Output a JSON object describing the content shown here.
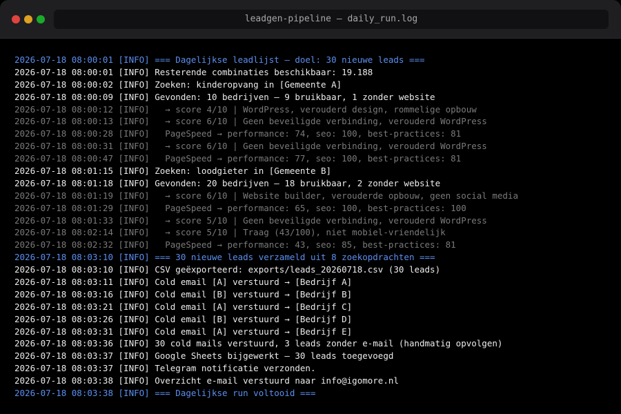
{
  "window": {
    "title": "leadgen-pipeline — daily_run.log"
  },
  "colors": {
    "bright": "#ececec",
    "dim": "#7a7a7a",
    "accent": "#5b8ff0"
  },
  "log": {
    "lines": [
      {
        "text": "2026-07-18 08:00:01 [INFO] === Dagelijkse leadlijst — doel: 30 nieuwe leads ===",
        "style": "accent"
      },
      {
        "text": "2026-07-18 08:00:01 [INFO] Resterende combinaties beschikbaar: 19.188",
        "style": "bright"
      },
      {
        "text": "2026-07-18 08:00:02 [INFO] Zoeken: kinderopvang in [Gemeente A]",
        "style": "bright"
      },
      {
        "text": "2026-07-18 08:00:09 [INFO] Gevonden: 10 bedrijven — 9 bruikbaar, 1 zonder website",
        "style": "bright"
      },
      {
        "text": "2026-07-18 08:00:12 [INFO]   → score 4/10 | WordPress, verouderd design, rommelige opbouw",
        "style": "dim"
      },
      {
        "text": "2026-07-18 08:00:13 [INFO]   → score 6/10 | Geen beveiligde verbinding, verouderd WordPress",
        "style": "dim"
      },
      {
        "text": "2026-07-18 08:00:28 [INFO]   PageSpeed → performance: 74, seo: 100, best-practices: 81",
        "style": "dim"
      },
      {
        "text": "2026-07-18 08:00:31 [INFO]   → score 6/10 | Geen beveiligde verbinding, verouderd WordPress",
        "style": "dim"
      },
      {
        "text": "2026-07-18 08:00:47 [INFO]   PageSpeed → performance: 77, seo: 100, best-practices: 81",
        "style": "dim"
      },
      {
        "text": "2026-07-18 08:01:15 [INFO] Zoeken: loodgieter in [Gemeente B]",
        "style": "bright"
      },
      {
        "text": "2026-07-18 08:01:18 [INFO] Gevonden: 20 bedrijven — 18 bruikbaar, 2 zonder website",
        "style": "bright"
      },
      {
        "text": "2026-07-18 08:01:19 [INFO]   → score 6/10 | Website builder, verouderde opbouw, geen social media",
        "style": "dim"
      },
      {
        "text": "2026-07-18 08:01:29 [INFO]   PageSpeed → performance: 65, seo: 100, best-practices: 100",
        "style": "dim"
      },
      {
        "text": "2026-07-18 08:01:33 [INFO]   → score 5/10 | Geen beveiligde verbinding, verouderd WordPress",
        "style": "dim"
      },
      {
        "text": "2026-07-18 08:02:14 [INFO]   → score 5/10 | Traag (43/100), niet mobiel-vriendelijk",
        "style": "dim"
      },
      {
        "text": "2026-07-18 08:02:32 [INFO]   PageSpeed → performance: 43, seo: 85, best-practices: 81",
        "style": "dim"
      },
      {
        "text": "2026-07-18 08:03:10 [INFO] === 30 nieuwe leads verzameld uit 8 zoekopdrachten ===",
        "style": "accent"
      },
      {
        "text": "2026-07-18 08:03:10 [INFO] CSV geëxporteerd: exports/leads_20260718.csv (30 leads)",
        "style": "bright"
      },
      {
        "text": "2026-07-18 08:03:11 [INFO] Cold email [A] verstuurd → [Bedrijf A]",
        "style": "bright"
      },
      {
        "text": "2026-07-18 08:03:16 [INFO] Cold email [B] verstuurd → [Bedrijf B]",
        "style": "bright"
      },
      {
        "text": "2026-07-18 08:03:21 [INFO] Cold email [A] verstuurd → [Bedrijf C]",
        "style": "bright"
      },
      {
        "text": "2026-07-18 08:03:26 [INFO] Cold email [B] verstuurd → [Bedrijf D]",
        "style": "bright"
      },
      {
        "text": "2026-07-18 08:03:31 [INFO] Cold email [A] verstuurd → [Bedrijf E]",
        "style": "bright"
      },
      {
        "text": "2026-07-18 08:03:36 [INFO] 30 cold mails verstuurd, 3 leads zonder e-mail (handmatig opvolgen)",
        "style": "bright"
      },
      {
        "text": "2026-07-18 08:03:37 [INFO] Google Sheets bijgewerkt — 30 leads toegevoegd",
        "style": "bright"
      },
      {
        "text": "2026-07-18 08:03:37 [INFO] Telegram notificatie verzonden.",
        "style": "bright"
      },
      {
        "text": "2026-07-18 08:03:38 [INFO] Overzicht e-mail verstuurd naar info@igomore.nl",
        "style": "bright"
      },
      {
        "text": "2026-07-18 08:03:38 [INFO] === Dagelijkse run voltooid ===",
        "style": "accent"
      }
    ]
  }
}
